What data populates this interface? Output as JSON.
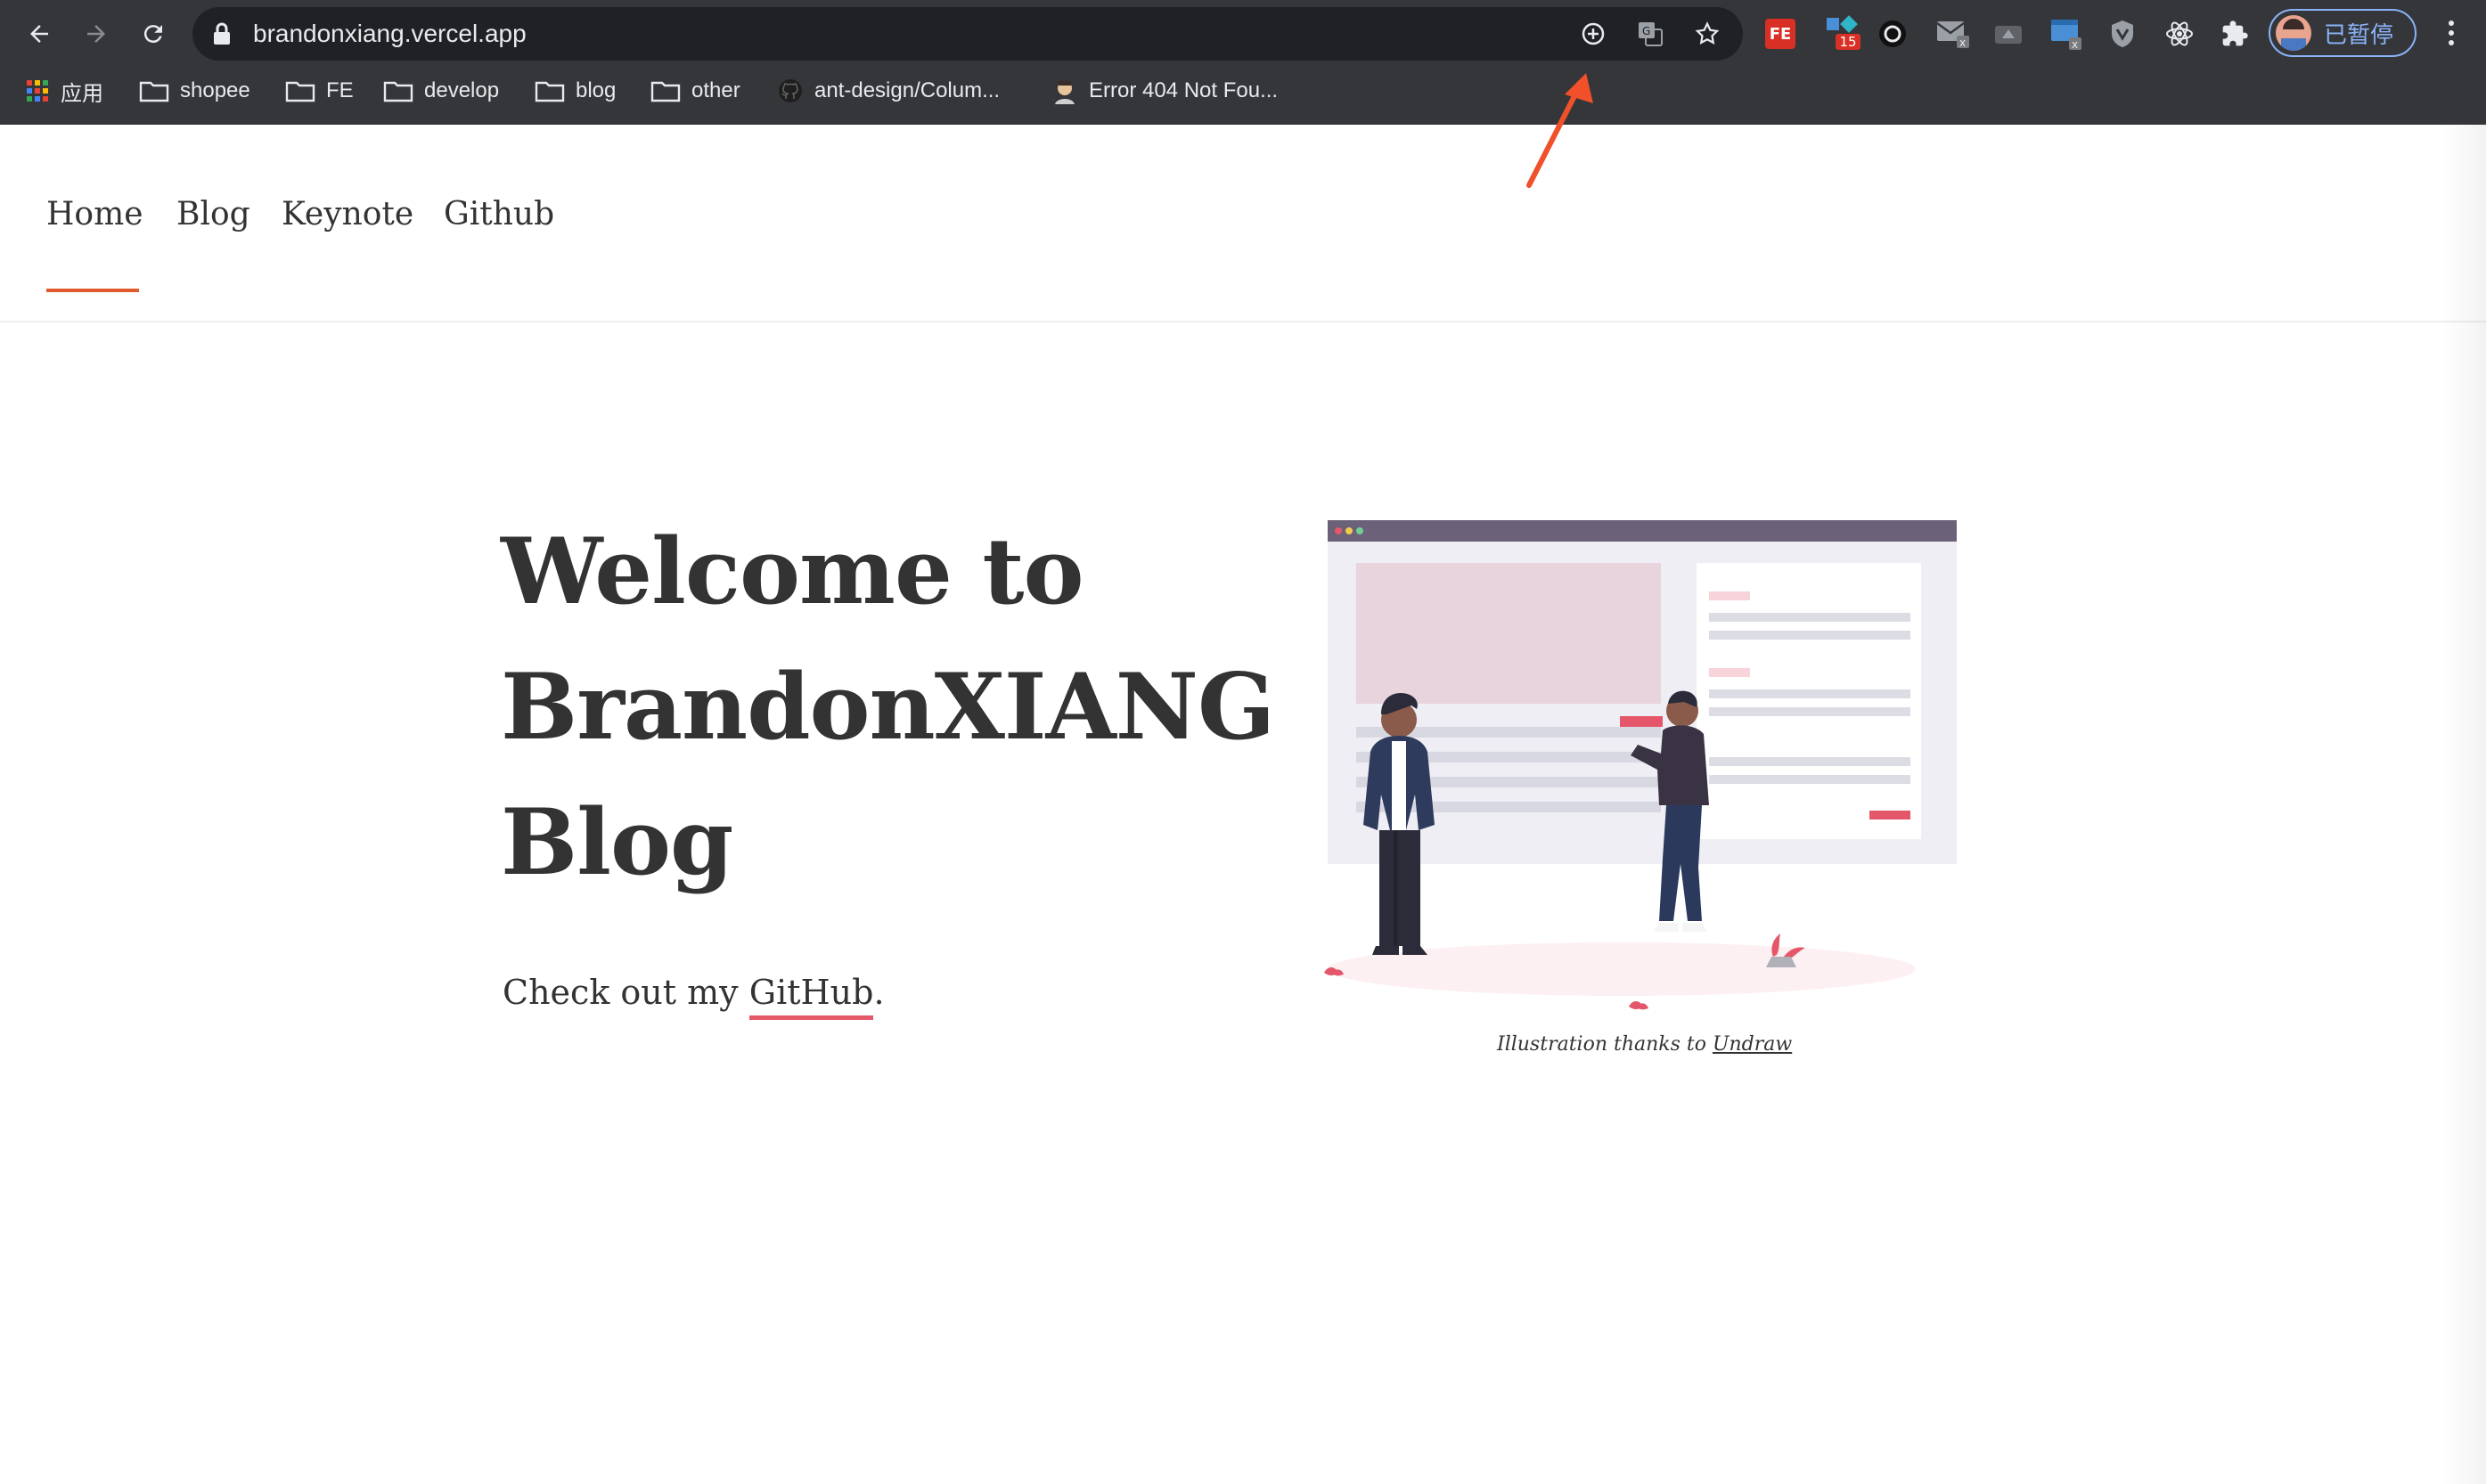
{
  "browser": {
    "url": "brandonxiang.vercel.app",
    "profile_label": "已暂停",
    "extension_badge": "15",
    "extension_fe_label": "FE",
    "bookmarks": [
      {
        "icon": "apps-grid-icon",
        "label": "应用"
      },
      {
        "icon": "folder-icon",
        "label": "shopee"
      },
      {
        "icon": "folder-icon",
        "label": "FE"
      },
      {
        "icon": "folder-icon",
        "label": "develop"
      },
      {
        "icon": "folder-icon",
        "label": "blog"
      },
      {
        "icon": "folder-icon",
        "label": "other"
      },
      {
        "icon": "github-icon",
        "label": "ant-design/Colum..."
      },
      {
        "icon": "avatar-icon",
        "label": "Error 404 Not Fou..."
      }
    ]
  },
  "site": {
    "nav": [
      "Home",
      "Blog",
      "Keynote",
      "Github"
    ],
    "active_nav": "Home",
    "hero_lines": [
      "Welcome to",
      "BrandonXIANG",
      "Blog"
    ],
    "sub_prefix": "Check out my ",
    "sub_link": "GitHub",
    "sub_suffix": ".",
    "caption_prefix": "Illustration thanks to ",
    "caption_link": "Undraw"
  },
  "colors": {
    "chrome": "#35363a",
    "accent_underline": "#e05a2b",
    "link_underline": "#e4576a",
    "annotation_arrow": "#f0502a"
  }
}
